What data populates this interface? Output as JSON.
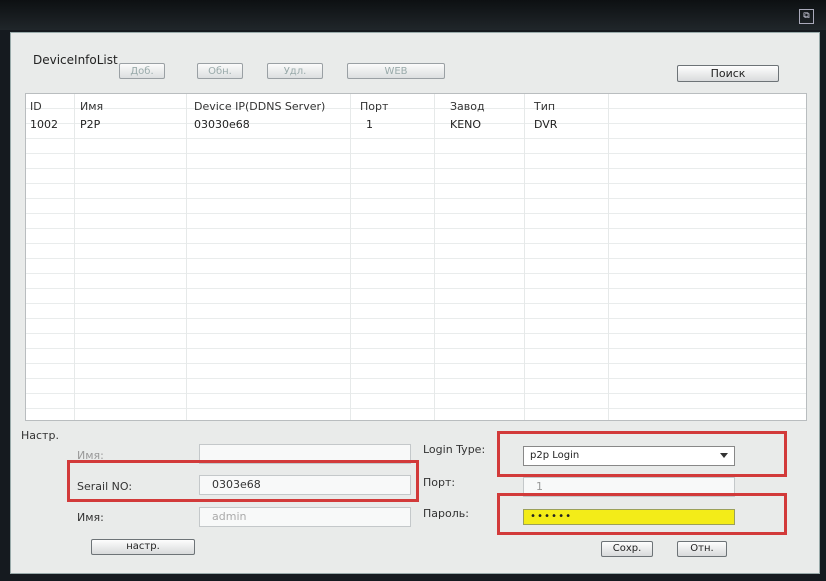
{
  "window": {
    "list_title": "DeviceInfoList",
    "corner_icon": "window-restore-icon"
  },
  "toolbar": {
    "add_label": "Доб.",
    "refresh_label": "Обн.",
    "delete_label": "Удл.",
    "web_label": "WEB",
    "search_label": "Поиск"
  },
  "table": {
    "columns": [
      "ID",
      "Имя",
      "Device IP(DDNS Server)",
      "Порт",
      "Завод",
      "Тип"
    ],
    "rows": [
      [
        "1002",
        "P2P",
        "03030e68",
        "1",
        "KENO",
        "DVR"
      ]
    ]
  },
  "settings": {
    "section_label": "Настр.",
    "name_label_top": "Имя:",
    "name_top_value": "",
    "serial_label": "Serail NO:",
    "serial_value": "0303e68",
    "user_label": "Имя:",
    "user_value": "admin",
    "login_type_label": "Login Type:",
    "login_type_value": "p2p Login",
    "port_label": "Порт:",
    "port_value": "1",
    "password_label": "Пароль:",
    "password_value": "••••••",
    "setup_button": "настр.",
    "save_button": "Сохр.",
    "cancel_button": "Отн."
  },
  "colors": {
    "highlight": "#d23a3a",
    "password_bg": "#f3ec18"
  }
}
